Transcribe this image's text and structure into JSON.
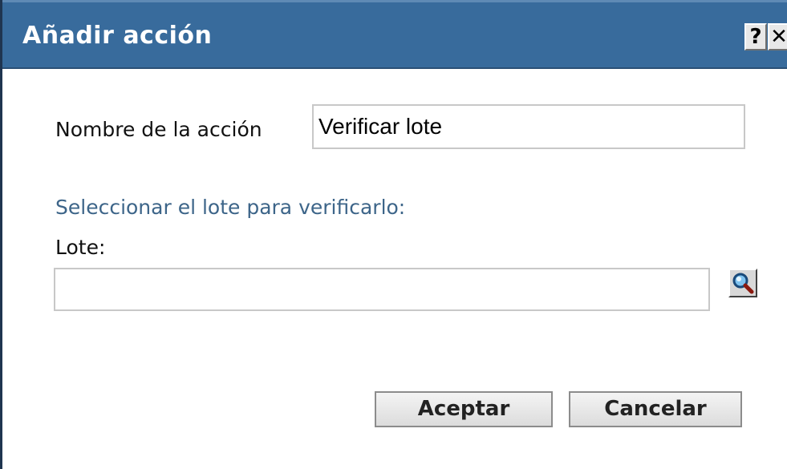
{
  "dialog": {
    "title": "Añadir acción",
    "help_label": "?",
    "close_label": "✕"
  },
  "form": {
    "action_name_label": "Nombre de la acción",
    "action_name_value": "Verificar lote",
    "section_heading": "Seleccionar el lote para verificarlo:",
    "lote_label": "Lote:",
    "lote_value": ""
  },
  "buttons": {
    "accept_label": "Aceptar",
    "cancel_label": "Cancelar"
  },
  "icons": {
    "search": "magnifier-icon"
  },
  "colors": {
    "titlebar": "#386b9c",
    "section_heading": "#3d6589"
  }
}
